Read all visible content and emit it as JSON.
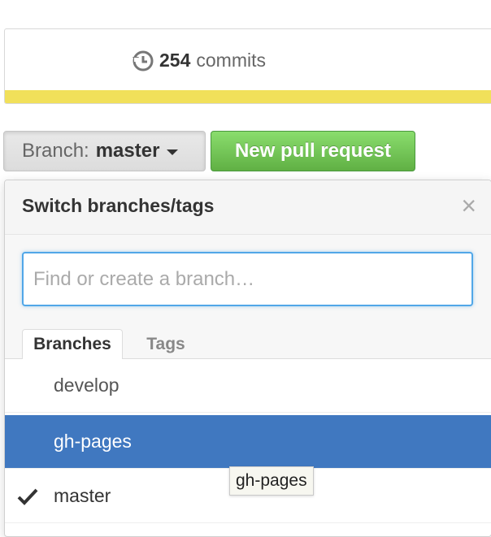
{
  "summary": {
    "commit_count": "254",
    "commit_label": "commits",
    "language_bar_color": "#f1e05a"
  },
  "branch_button": {
    "prefix": "Branch:",
    "value": "master"
  },
  "new_pull_request": {
    "label": "New pull request"
  },
  "menu": {
    "title": "Switch branches/tags",
    "close_glyph": "×",
    "filter_placeholder": "Find or create a branch…",
    "tabs": [
      {
        "label": "Branches",
        "selected": true
      },
      {
        "label": "Tags",
        "selected": false
      }
    ],
    "items": [
      {
        "label": "develop",
        "checked": false,
        "highlighted": false
      },
      {
        "label": "gh-pages",
        "checked": false,
        "highlighted": true
      },
      {
        "label": "master",
        "checked": true,
        "highlighted": false
      }
    ]
  },
  "tooltip": {
    "text": "gh-pages"
  },
  "colors": {
    "highlight": "#4078c0",
    "focus_ring": "#51a7e8",
    "primary_button": "#60b044"
  },
  "icons": {
    "history": "history-icon",
    "caret": "caret-down-icon",
    "close": "close-icon",
    "check": "check-icon"
  }
}
